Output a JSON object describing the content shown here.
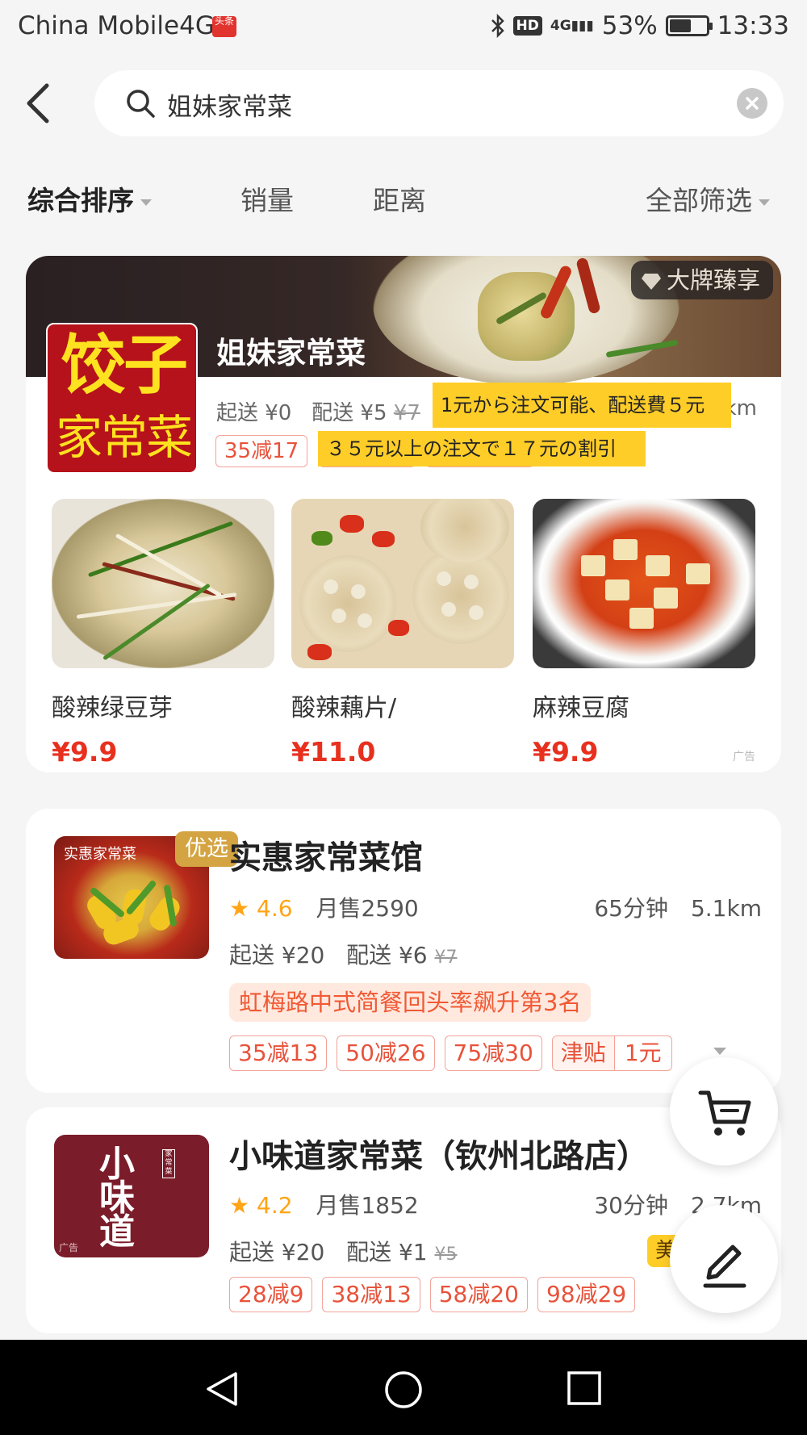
{
  "status_bar": {
    "carrier": "China Mobile4G",
    "app_badge": "头条",
    "bluetooth_icon": "bluetooth-icon",
    "hd": "HD",
    "network": "4G",
    "battery": "53%",
    "time": "13:33"
  },
  "search": {
    "query": "姐妹家常菜"
  },
  "sort_tabs": {
    "composite": "综合排序",
    "sales": "销量",
    "distance": "距离",
    "filter": "全部筛选"
  },
  "featured": {
    "brand_tag": "大牌臻享",
    "logo_big": "饺子",
    "logo_small": "家常菜",
    "name": "姐妹家常菜",
    "min_order": "起送 ¥0",
    "delivery_fee": "配送 ¥5",
    "delivery_fee_original": "¥7",
    "distance_partial": "km",
    "overlay_1": "1元から注文可能、配送費５元",
    "overlay_2": "３５元以上の注文で１７元の割引",
    "promo": "35减17",
    "dishes": [
      {
        "name": "酸辣绿豆芽",
        "price": "¥9.9"
      },
      {
        "name": "酸辣藕片/",
        "price": "¥11.0"
      },
      {
        "name": "麻辣豆腐",
        "price": "¥9.9"
      }
    ],
    "ad_label": "广告"
  },
  "store_1": {
    "tag": "优选",
    "thumb_text": "实惠家常菜",
    "name": "实惠家常菜馆",
    "rating": "4.6",
    "monthly_sales": "月售2590",
    "time": "65分钟",
    "distance": "5.1km",
    "min_order": "起送 ¥20",
    "delivery_fee": "配送 ¥6",
    "delivery_fee_original": "¥7",
    "rank": "虹梅路中式简餐回头率飙升第3名",
    "promos": [
      "35减13",
      "50减26",
      "75减30"
    ],
    "subsidy_label": "津贴",
    "subsidy_value": "1元"
  },
  "store_2": {
    "thumb_text": "小味道",
    "thumb_seal": "家常菜",
    "thumb_ad": "广告",
    "name": "小味道家常菜（钦州北路店）",
    "rating": "4.2",
    "monthly_sales": "月售1852",
    "time": "30分钟",
    "distance": "2.7km",
    "min_order": "起送 ¥20",
    "delivery_fee": "配送 ¥1",
    "delivery_fee_original": "¥5",
    "badge": "美",
    "promos": [
      "28减9",
      "38减13",
      "58减20",
      "98减29"
    ]
  },
  "colors": {
    "accent_price": "#e8301f",
    "promo": "#e8523a",
    "star": "#ffa416",
    "highlight": "#ffcd28"
  }
}
